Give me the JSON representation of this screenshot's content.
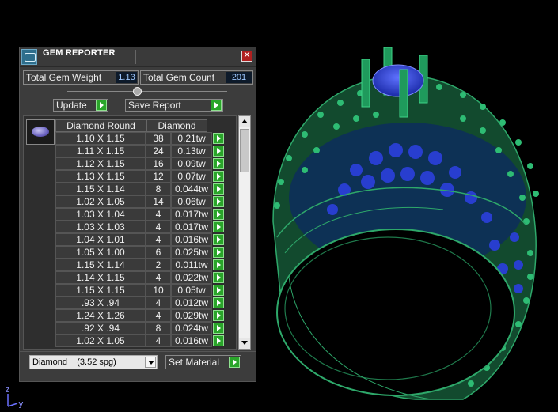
{
  "panel": {
    "title": "GEM REPORTER",
    "close_glyph": "✕",
    "total_weight_label": "Total Gem Weight",
    "total_weight_value": "1.13",
    "total_count_label": "Total Gem Count",
    "total_count_value": "201",
    "update_label": "Update",
    "save_report_label": "Save Report",
    "table": {
      "header_shape": "Diamond Round",
      "header_material": "Diamond",
      "rows": [
        {
          "size": "1.10 X 1.15",
          "count": "38",
          "weight": "0.21tw"
        },
        {
          "size": "1.11 X 1.15",
          "count": "24",
          "weight": "0.13tw"
        },
        {
          "size": "1.12 X 1.15",
          "count": "16",
          "weight": "0.09tw"
        },
        {
          "size": "1.13 X 1.15",
          "count": "12",
          "weight": "0.07tw"
        },
        {
          "size": "1.15 X 1.14",
          "count": "8",
          "weight": "0.044tw"
        },
        {
          "size": "1.02 X 1.05",
          "count": "14",
          "weight": "0.06tw"
        },
        {
          "size": "1.03 X 1.04",
          "count": "4",
          "weight": "0.017tw"
        },
        {
          "size": "1.03 X 1.03",
          "count": "4",
          "weight": "0.017tw"
        },
        {
          "size": "1.04 X 1.01",
          "count": "4",
          "weight": "0.016tw"
        },
        {
          "size": "1.05 X 1.00",
          "count": "6",
          "weight": "0.025tw"
        },
        {
          "size": "1.15 X 1.14",
          "count": "2",
          "weight": "0.011tw"
        },
        {
          "size": "1.14 X 1.15",
          "count": "4",
          "weight": "0.022tw"
        },
        {
          "size": "1.15 X 1.15",
          "count": "10",
          "weight": "0.05tw"
        },
        {
          "size": ".93 X .94",
          "count": "4",
          "weight": "0.012tw"
        },
        {
          "size": "1.24 X 1.26",
          "count": "4",
          "weight": "0.029tw"
        },
        {
          "size": ".92 X .94",
          "count": "8",
          "weight": "0.024tw"
        },
        {
          "size": "1.02 X 1.05",
          "count": "4",
          "weight": "0.016tw"
        }
      ]
    },
    "material_select_value": "Diamond    (3.52 spg)",
    "set_material_label": "Set Material"
  },
  "viewport": {
    "axis_z": "z",
    "axis_y": "y",
    "metal_color": "#1f8a55",
    "stone_color": "#2a3fd6"
  },
  "icons": [
    "gem-reporter-app-icon",
    "close-icon",
    "arrow-right-icon",
    "scroll-up-icon",
    "scroll-down-icon",
    "dropdown-arrow-icon",
    "gem-thumbnail-icon"
  ]
}
